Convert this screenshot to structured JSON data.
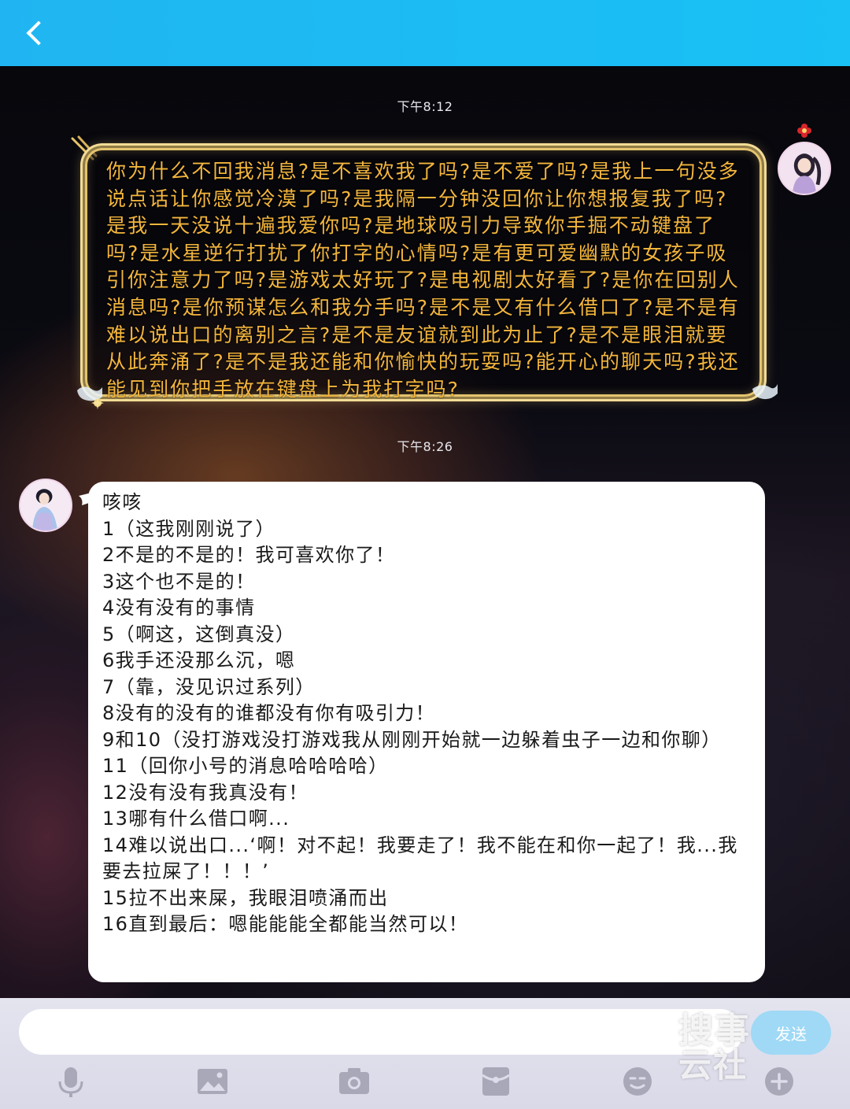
{
  "header": {
    "back_icon": "chevron-left-icon"
  },
  "chat": {
    "timestamps": [
      "下午8:12",
      "下午8:26"
    ],
    "outgoing_message": "你为什么不回我消息?是不喜欢我了吗?是不爱了吗?是我上一句没多说点话让你感觉冷漠了吗?是我隔一分钟没回你让你想报复我了吗?是我一天没说十遍我爱你吗?是地球吸引力导致你手掘不动键盘了吗?是水星逆行打扰了你打字的心情吗?是有更可爱幽默的女孩子吸引你注意力了吗?是游戏太好玩了?是电视剧太好看了?是你在回别人消息吗?是你预谋怎么和我分手吗?是不是又有什么借口了?是不是有难以说出口的离别之言?是不是友谊就到此为止了?是不是眼泪就要从此奔涌了?是不是我还能和你愉快的玩耍吗?能开心的聊天吗?我还能见到你把手放在键盘上为我打字吗?",
    "incoming_lines": [
      "咳咳",
      "1（这我刚刚说了）",
      "2不是的不是的！我可喜欢你了！",
      "3这个也不是的！",
      "4没有没有的事情",
      "5（啊这，这倒真没）",
      "6我手还没那么沉，嗯",
      "7（靠，没见识过系列）",
      "8没有的没有的谁都没有你有吸引力！",
      "9和10（没打游戏没打游戏我从刚刚开始就一边躲着虫子一边和你聊）",
      "11（回你小号的消息哈哈哈哈）",
      "12没有没有我真没有！",
      "13哪有什么借口啊...",
      "14难以说出口...‘啊！对不起！我要走了！我不能在和你一起了！我...我要去拉屎了！！！’",
      "15拉不出来屎，我眼泪喷涌而出",
      "16直到最后：嗯能能能全都能当然可以！"
    ]
  },
  "input_bar": {
    "input_value": "",
    "send_label": "发送",
    "icons": [
      "microphone-icon",
      "image-icon",
      "camera-icon",
      "red-packet-icon",
      "emoji-icon",
      "plus-icon"
    ]
  },
  "watermark": {
    "line1": "搜事",
    "line2": "云社"
  },
  "colors": {
    "header_blue": "#1ab9f3",
    "gold_text": "#f4b63c",
    "send_button": "#9fd9f6"
  }
}
